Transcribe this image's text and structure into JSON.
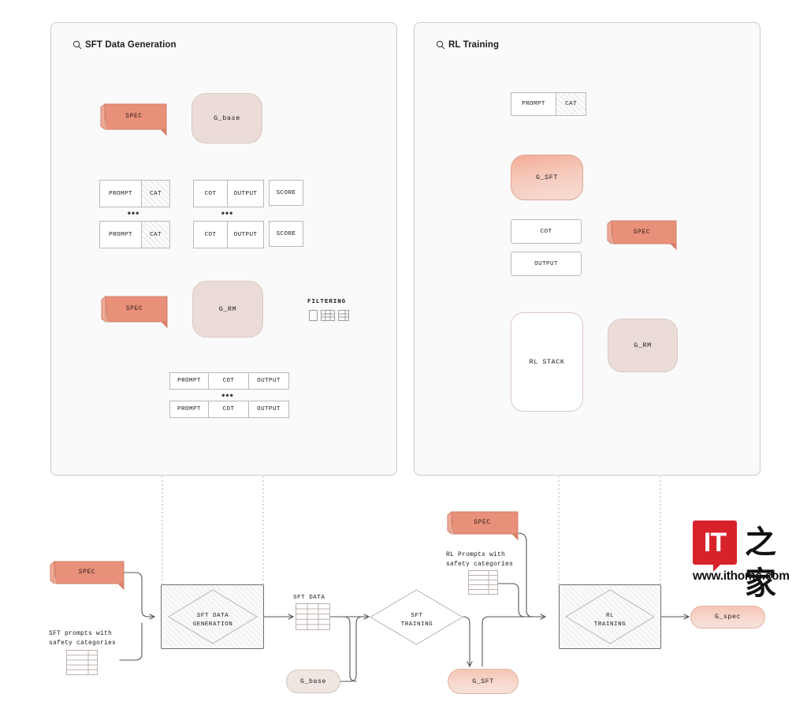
{
  "panels": [
    {
      "id": "sft",
      "title": "SFT Data Generation",
      "icon": "search-icon"
    },
    {
      "id": "rl",
      "title": "RL Training",
      "icon": "search-icon"
    }
  ],
  "sft_panel": {
    "spec_top": "SPEC",
    "g_base": "G_base",
    "spec_rm": "SPEC",
    "g_rm": "G_RM",
    "ellipsis": "•••",
    "filtering_label": "FILTERING",
    "prompt_rows": [
      {
        "cells": [
          "PROMPT",
          "CAT"
        ]
      },
      {
        "cells": [
          "PROMPT",
          "CAT"
        ]
      }
    ],
    "cot_rows": [
      {
        "cells": [
          "COT",
          "OUTPUT"
        ]
      },
      {
        "cells": [
          "COT",
          "OUTPUT"
        ]
      }
    ],
    "score_rows": [
      "SCORE",
      "SCORE"
    ],
    "final_rows": [
      {
        "cells": [
          "PROMPT",
          "COT",
          "OUTPUT"
        ]
      },
      {
        "cells": [
          "PROMPT",
          "COT",
          "OUTPUT"
        ]
      }
    ]
  },
  "rl_panel": {
    "prompt_cat": [
      "PROMPT",
      "CAT"
    ],
    "g_sft": "G_SFT",
    "cot": "COT",
    "output": "OUTPUT",
    "spec": "SPEC",
    "rl_stack": "RL STACK",
    "g_rm": "G_RM"
  },
  "flow": {
    "spec_left": "SPEC",
    "sft_prompts_caption": "SFT prompts with\nsafety categories",
    "sft_data_generation": "SFT DATA\nGENERATION",
    "sft_data_label": "SFT DATA",
    "g_base": "G_base",
    "sft_training": "SFT\nTRAINING",
    "g_sft": "G_SFT",
    "spec_mid": "SPEC",
    "rl_prompts_caption": "RL Prompts with\nsafety categories",
    "rl_training": "RL\nTRAINING",
    "g_spec": "G_spec"
  },
  "watermark": {
    "mark": "IT",
    "cn": "之家",
    "url": "www.ithome.com"
  },
  "colors": {
    "panel_bg": "#fafafa",
    "panel_border": "#c9c9c9",
    "spec_fill": "#e8907a",
    "spec_edge": "#d07d67",
    "blob_fill": "#ecdcd7",
    "gsft_fill": "#f2ab95",
    "connector": "#555555",
    "dotted": "#9a9a9a",
    "watermark_red": "#d7222a"
  }
}
